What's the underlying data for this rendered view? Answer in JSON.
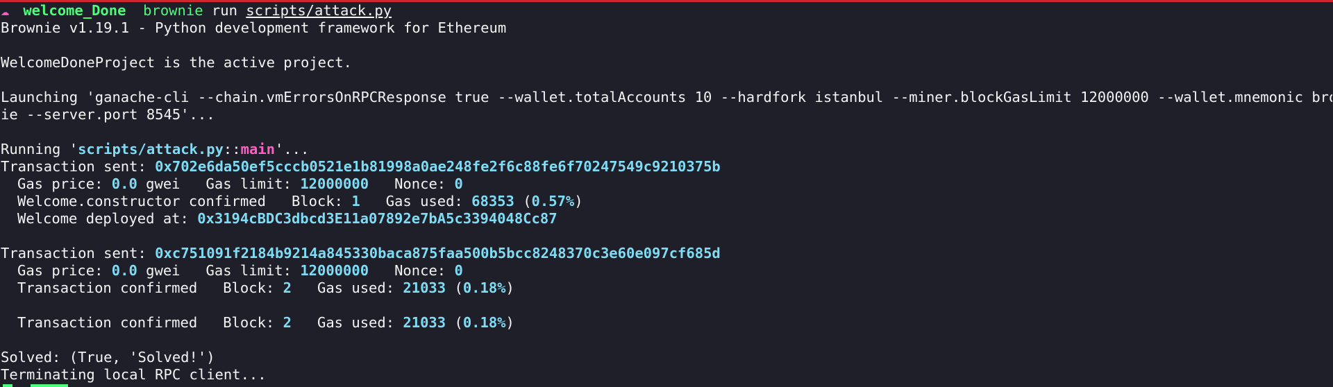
{
  "prompt": {
    "icon": "cloud-icon",
    "icon_glyph": "☁",
    "directory": "welcome_Done",
    "command": "brownie",
    "args": "run",
    "script_path": "scripts/attack.py"
  },
  "output": {
    "banner": "Brownie v1.19.1 - Python development framework for Ethereum",
    "active_project": "WelcomeDoneProject is the active project.",
    "launching_1": "Launching 'ganache-cli --chain.vmErrorsOnRPCResponse true --wallet.totalAccounts 10 --hardfork istanbul --miner.blockGasLimit 12000000 --wallet.mnemonic brown",
    "launching_2": "ie --server.port 8545'...",
    "running": {
      "prefix": "Running '",
      "script": "scripts/attack.py",
      "sep": "::",
      "func": "main",
      "suffix": "'..."
    },
    "tx1": {
      "label": "Transaction sent: ",
      "hash": "0x702e6da50ef5cccb0521e1b81998a0ae248fe2f6c88fe6f70247549c9210375b",
      "gas_price_label": "Gas price: ",
      "gas_price": "0.0",
      "gas_price_unit": " gwei   ",
      "gas_limit_label": "Gas limit: ",
      "gas_limit": "12000000",
      "nonce_label": "   Nonce: ",
      "nonce": "0",
      "confirmed_label": "Welcome.constructor confirmed   Block: ",
      "block": "1",
      "gas_used_label": "   Gas used: ",
      "gas_used": "68353",
      "gas_used_pct": "0.57%",
      "deployed_label": "Welcome deployed at: ",
      "deployed_address": "0x3194cBDC3dbcd3E11a07892e7bA5c3394048Cc87"
    },
    "tx2": {
      "label": "Transaction sent: ",
      "hash": "0xc751091f2184b9214a845330baca875faa500b5bcc8248370c3e60e097cf685d",
      "gas_price_label": "Gas price: ",
      "gas_price": "0.0",
      "gas_price_unit": " gwei   ",
      "gas_limit_label": "Gas limit: ",
      "gas_limit": "12000000",
      "nonce_label": "   Nonce: ",
      "nonce": "0",
      "confirmed_label": "Transaction confirmed   Block: ",
      "block": "2",
      "gas_used_label": "   Gas used: ",
      "gas_used": "21033",
      "gas_used_pct": "0.18%"
    },
    "tx3": {
      "confirmed_label": "Transaction confirmed   Block: ",
      "block": "2",
      "gas_used_label": "   Gas used: ",
      "gas_used": "21033",
      "gas_used_pct": "0.18%"
    },
    "solved": "Solved: (True, 'Solved!')",
    "terminating": "Terminating local RPC client..."
  },
  "colors": {
    "background": "#1f1f29",
    "text": "#f4f4f4",
    "value_cyan": "#7fdcf5",
    "prompt_green": "#50fa7b",
    "func_pink": "#ff5fc4",
    "top_border_red": "#d0262f"
  }
}
